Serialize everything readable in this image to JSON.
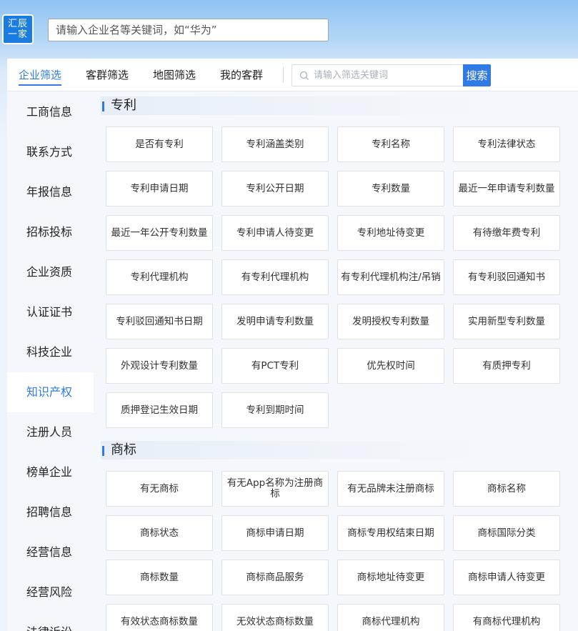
{
  "header": {
    "logo_line1": "汇辰",
    "logo_line2": "一家",
    "search_placeholder": "请输入企业名等关键词，如“华为”"
  },
  "tabs": [
    "企业筛选",
    "客群筛选",
    "地图筛选",
    "我的客群"
  ],
  "active_tab": "企业筛选",
  "filter": {
    "placeholder": "请输入筛选关键词",
    "button_label": "搜索"
  },
  "sidebar": {
    "active": "知识产权",
    "items": [
      "工商信息",
      "联系方式",
      "年报信息",
      "招标投标",
      "企业资质",
      "认证证书",
      "科技企业",
      "知识产权",
      "注册人员",
      "榜单企业",
      "招聘信息",
      "经营信息",
      "经营风险",
      "法律诉讼"
    ]
  },
  "sections": [
    {
      "title": "专利",
      "items": [
        "是否有专利",
        "专利涵盖类别",
        "专利名称",
        "专利法律状态",
        "专利申请日期",
        "专利公开日期",
        "专利数量",
        "最近一年申请专利数量",
        "最近一年公开专利数量",
        "专利申请人待变更",
        "专利地址待变更",
        "有待缴年费专利",
        "专利代理机构",
        "有专利代理机构",
        "有专利代理机构注/吊销",
        "有专利驳回通知书",
        "专利驳回通知书日期",
        "发明申请专利数量",
        "发明授权专利数量",
        "实用新型专利数量",
        "外观设计专利数量",
        "有PCT专利",
        "优先权时间",
        "有质押专利",
        "质押登记生效日期",
        "专利到期时间"
      ]
    },
    {
      "title": "商标",
      "items": [
        "有无商标",
        "有无App名称为注册商标",
        "有无品牌未注册商标",
        "商标名称",
        "商标状态",
        "商标申请日期",
        "商标专用权结束日期",
        "商标国际分类",
        "商标数量",
        "商标商品服务",
        "商标地址待变更",
        "商标申请人待变更",
        "有效状态商标数量",
        "无效状态商标数量",
        "商标代理机构",
        "有商标代理机构"
      ]
    }
  ]
}
